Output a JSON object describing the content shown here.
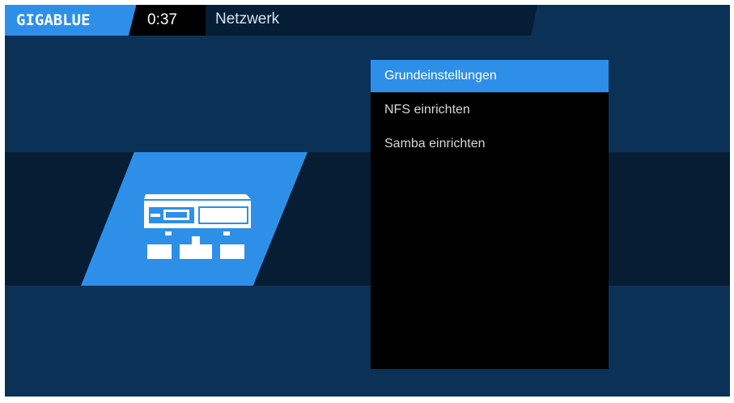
{
  "header": {
    "logo": "GIGABLUE",
    "clock": "0:37",
    "title": "Netzwerk"
  },
  "menu": {
    "items": [
      {
        "label": "Grundeinstellungen",
        "selected": true
      },
      {
        "label": "NFS einrichten",
        "selected": false
      },
      {
        "label": "Samba einrichten",
        "selected": false
      }
    ]
  },
  "tile": {
    "icon": "network-icon"
  },
  "colors": {
    "accent": "#2e8fe8",
    "background": "#0c3156",
    "band": "#061d33",
    "menu_bg": "#000000"
  }
}
